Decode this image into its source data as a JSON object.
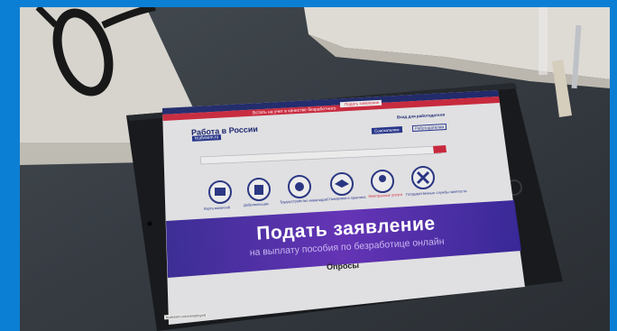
{
  "scene": {
    "tablet": {
      "site_name": "Работа в России",
      "site_tagline": "trudvsem.ru",
      "top_notice": "Встать на учет в качестве безработного",
      "top_button": "Подать заявление",
      "header_link": "Вход для работодателя",
      "header_btn_1": "Соискателям",
      "header_btn_2": "Работодателям",
      "category_links": [
        "Карта вакансий",
        "Добровольцам",
        "Трудоустройство инвалидов",
        "Стажировки и практика",
        "Электронные услуги",
        "Государственные службы занятости"
      ],
      "banner_title": "Подать заявление",
      "banner_subtitle": "на выплату пособия по безработице онлайн",
      "section_heading": "Опросы",
      "status_url": "trudvsem.ru/unemployed"
    },
    "colors": {
      "outer_border": "#0b7fd3",
      "desk": "#3b4148",
      "tablet_body": "#1b1d20",
      "site_red": "#d7263d",
      "site_blue": "#27358a",
      "banner_purple": "#5b2fb0"
    }
  }
}
